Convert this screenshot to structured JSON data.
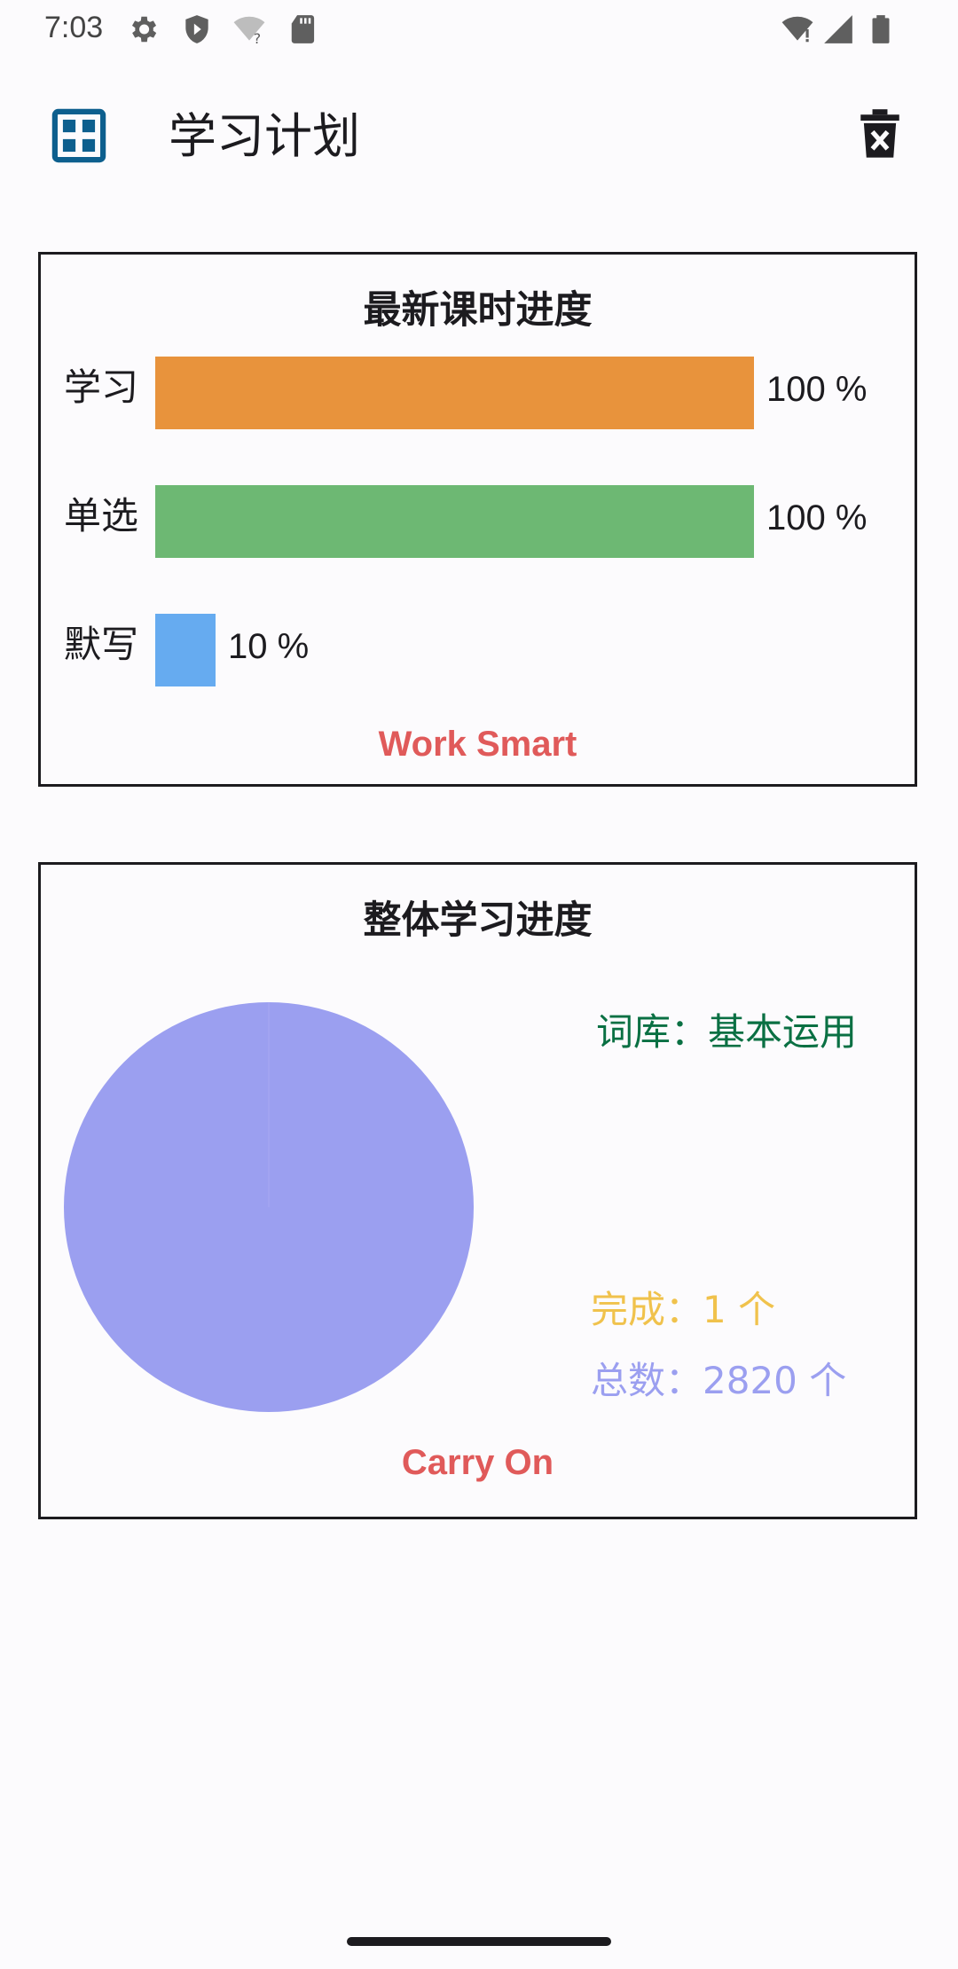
{
  "status_bar": {
    "time": "7:03",
    "icons": [
      "gear-icon",
      "shield-icon",
      "wifi-question-icon",
      "sd-card-icon",
      "wifi-alert-icon",
      "signal-icon",
      "battery-icon"
    ]
  },
  "app_bar": {
    "title": "学习计划",
    "left_icon": "grid-icon",
    "right_icon": "delete-icon"
  },
  "lesson_card": {
    "title": "最新课时进度",
    "footer": "Work Smart",
    "rows": [
      {
        "label": "学习",
        "value_text": "100 %",
        "progress": 1.0,
        "color": "#e8933c"
      },
      {
        "label": "单选",
        "value_text": "100 %",
        "progress": 1.0,
        "color": "#6db873"
      },
      {
        "label": "默写",
        "value_text": "10 %",
        "progress": 0.1,
        "color": "#66abf0"
      }
    ]
  },
  "overall_card": {
    "title": "整体学习进度",
    "footer": "Carry On",
    "lexicon": "词库：基本运用",
    "completed": "完成：1 个",
    "total": "总数：2820 个",
    "colors": {
      "lexicon": "#0a7043",
      "completed": "#f0c24c",
      "total": "#9b9ff0",
      "pie_remaining": "#9b9ff0",
      "pie_completed": "#f0c24c"
    },
    "pie": {
      "completed": 1,
      "total": 2820
    }
  }
}
